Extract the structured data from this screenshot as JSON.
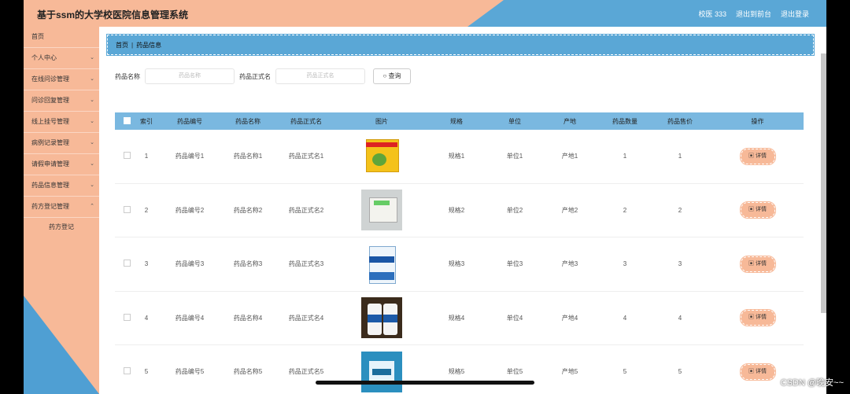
{
  "header": {
    "title": "基于ssm的大学校医院信息管理系统",
    "user": "校医 333",
    "back_front": "退出到前台",
    "logout": "退出登录"
  },
  "sidebar": {
    "items": [
      {
        "label": "首页",
        "expandable": false
      },
      {
        "label": "个人中心",
        "expandable": true
      },
      {
        "label": "在线问诊管理",
        "expandable": true
      },
      {
        "label": "问诊回复管理",
        "expandable": true
      },
      {
        "label": "线上挂号管理",
        "expandable": true
      },
      {
        "label": "病例记录管理",
        "expandable": true
      },
      {
        "label": "请假申请管理",
        "expandable": true
      },
      {
        "label": "药品信息管理",
        "expandable": true
      },
      {
        "label": "药方登记管理",
        "expandable": true
      }
    ],
    "sub_item": "药方登记"
  },
  "breadcrumb": {
    "home": "首页",
    "current": "药品信息"
  },
  "search": {
    "name_label": "药品名称",
    "name_placeholder": "药品名称",
    "formal_label": "药品正式名",
    "formal_placeholder": "药品正式名",
    "query_button": "查询"
  },
  "table": {
    "headers": [
      "索引",
      "药品编号",
      "药品名称",
      "药品正式名",
      "图片",
      "规格",
      "单位",
      "产地",
      "药品数量",
      "药品售价",
      "操作"
    ],
    "rows": [
      {
        "index": "1",
        "code": "药品编号1",
        "name": "药品名称1",
        "formal": "药品正式名1",
        "spec": "规格1",
        "unit": "单位1",
        "origin": "产地1",
        "qty": "1",
        "price": "1",
        "action": "详情"
      },
      {
        "index": "2",
        "code": "药品编号2",
        "name": "药品名称2",
        "formal": "药品正式名2",
        "spec": "规格2",
        "unit": "单位2",
        "origin": "产地2",
        "qty": "2",
        "price": "2",
        "action": "详情"
      },
      {
        "index": "3",
        "code": "药品编号3",
        "name": "药品名称3",
        "formal": "药品正式名3",
        "spec": "规格3",
        "unit": "单位3",
        "origin": "产地3",
        "qty": "3",
        "price": "3",
        "action": "详情"
      },
      {
        "index": "4",
        "code": "药品编号4",
        "name": "药品名称4",
        "formal": "药品正式名4",
        "spec": "规格4",
        "unit": "单位4",
        "origin": "产地4",
        "qty": "4",
        "price": "4",
        "action": "详情"
      },
      {
        "index": "5",
        "code": "药品编号5",
        "name": "药品名称5",
        "formal": "药品正式名5",
        "spec": "规格5",
        "unit": "单位5",
        "origin": "产地5",
        "qty": "5",
        "price": "5",
        "action": "详情"
      }
    ]
  },
  "watermark": "CSDN @晚安~~",
  "colors": {
    "accent_orange": "#f7b998",
    "accent_blue": "#5aa7d6"
  }
}
